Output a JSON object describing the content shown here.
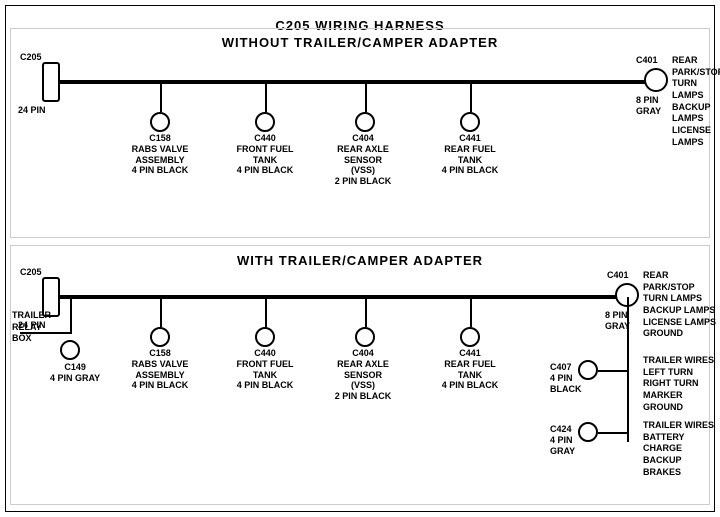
{
  "title": "C205 WIRING HARNESS",
  "section1": {
    "title": "WITHOUT TRAILER/CAMPER ADAPTER",
    "left_connector": {
      "label_top": "C205",
      "label_bottom": "24 PIN"
    },
    "right_connector": {
      "label_top": "C401",
      "label_right": "REAR PARK/STOP\nTURN LAMPS\nBACKUP LAMPS\nLICENSE LAMPS",
      "label_bottom": "8 PIN\nGRAY"
    },
    "connectors": [
      {
        "id": "C158",
        "label": "C158\nRABS VALVE\nASSEMBLY\n4 PIN BLACK"
      },
      {
        "id": "C440",
        "label": "C440\nFRONT FUEL\nTANK\n4 PIN BLACK"
      },
      {
        "id": "C404",
        "label": "C404\nREAR AXLE\nSENSOR\n(VSS)\n2 PIN BLACK"
      },
      {
        "id": "C441",
        "label": "C441\nREAR FUEL\nTANK\n4 PIN BLACK"
      }
    ]
  },
  "section2": {
    "title": "WITH TRAILER/CAMPER ADAPTER",
    "left_connector": {
      "label_top": "C205",
      "label_bottom": "24 PIN"
    },
    "trailer_relay": {
      "label": "TRAILER\nRELAY\nBOX"
    },
    "c149": {
      "label": "C149\n4 PIN GRAY"
    },
    "right_connector": {
      "label_top": "C401",
      "label_right": "REAR PARK/STOP\nTURN LAMPS\nBACKUP LAMPS\nLICENSE LAMPS\nGROUND",
      "label_bottom": "8 PIN\nGRAY"
    },
    "connectors": [
      {
        "id": "C158",
        "label": "C158\nRABS VALVE\nASSEMBLY\n4 PIN BLACK"
      },
      {
        "id": "C440",
        "label": "C440\nFRONT FUEL\nTANK\n4 PIN BLACK"
      },
      {
        "id": "C404",
        "label": "C404\nREAR AXLE\nSENSOR\n(VSS)\n2 PIN BLACK"
      },
      {
        "id": "C441",
        "label": "C441\nREAR FUEL\nTANK\n4 PIN BLACK"
      }
    ],
    "right_connectors": [
      {
        "id": "C407",
        "label_left": "C407\n4 PIN\nBLACK",
        "label_right": "TRAILER WIRES\nLEFT TURN\nRIGHT TURN\nMARKER\nGROUND"
      },
      {
        "id": "C424",
        "label_left": "C424\n4 PIN\nGRAY",
        "label_right": "TRAILER WIRES\nBATTERY CHARGE\nBACKUP\nBRAKES"
      }
    ]
  }
}
